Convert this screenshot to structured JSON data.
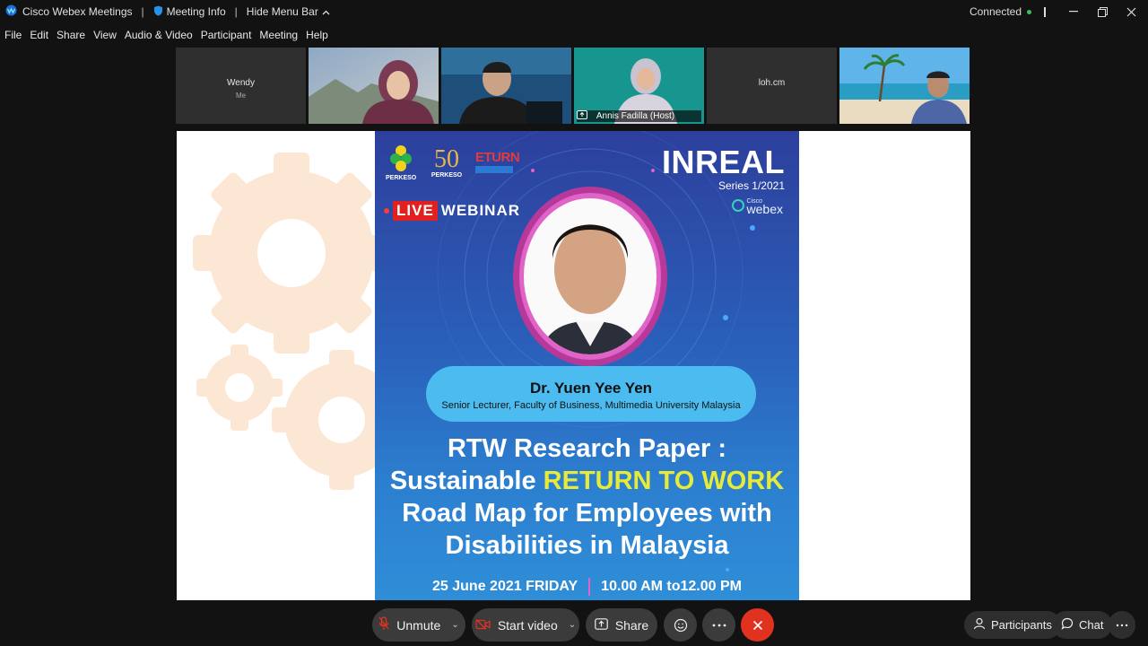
{
  "window": {
    "app_title": "Cisco Webex Meetings",
    "meeting_info": "Meeting Info",
    "hide_menu": "Hide Menu Bar",
    "status": "Connected",
    "status_color": "#3bbf5c"
  },
  "menu": [
    "File",
    "Edit",
    "Share",
    "View",
    "Audio & Video",
    "Participant",
    "Meeting",
    "Help"
  ],
  "participants": [
    {
      "name": "Wendy",
      "sub": "Me"
    },
    {
      "name": "",
      "sub": ""
    },
    {
      "name": "",
      "sub": ""
    },
    {
      "name": "Annis Fadilla  (Host)",
      "sub": ""
    },
    {
      "name": "loh.cm",
      "sub": ""
    },
    {
      "name": "",
      "sub": ""
    }
  ],
  "slide": {
    "logo1": "PERKESO",
    "logo2_num": "50",
    "logo2_text": "PERKESO",
    "logo3": "ETURN",
    "event": "INREAL",
    "series": "Series 1/2021",
    "brand_small": "Cisco",
    "brand": "webex",
    "live": "LIVE",
    "webinar": "WEBINAR",
    "speaker_name": "Dr. Yuen Yee Yen",
    "speaker_title": "Senior Lecturer, Faculty of Business, Multimedia University Malaysia",
    "title_line1": "RTW Research Paper :",
    "title_line2a": "Sustainable ",
    "title_line2b": "RETURN TO WORK",
    "title_line3": "Road Map for Employees with",
    "title_line4": "Disabilities in Malaysia",
    "date": "25 June 2021 FRIDAY",
    "time": "10.00 AM to12.00 PM"
  },
  "toolbar": {
    "unmute": "Unmute",
    "start_video": "Start video",
    "share": "Share",
    "participants": "Participants",
    "chat": "Chat"
  },
  "colors": {
    "accent": "#27b2e3",
    "end_call": "#e0321f",
    "highlight_yellow": "#e8ea3a"
  }
}
